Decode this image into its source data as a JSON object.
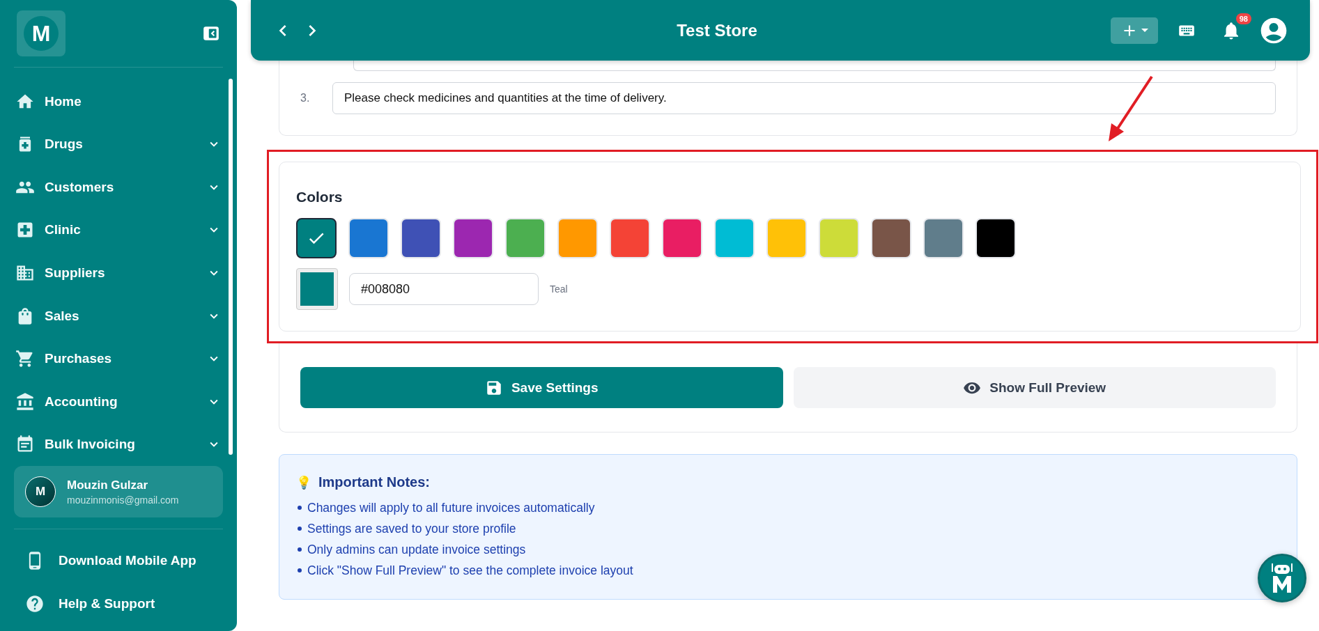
{
  "sidebar": {
    "logo": "M",
    "nav": [
      {
        "label": "Home",
        "expandable": false
      },
      {
        "label": "Drugs",
        "expandable": true
      },
      {
        "label": "Customers",
        "expandable": true
      },
      {
        "label": "Clinic",
        "expandable": true
      },
      {
        "label": "Suppliers",
        "expandable": true
      },
      {
        "label": "Sales",
        "expandable": true
      },
      {
        "label": "Purchases",
        "expandable": true
      },
      {
        "label": "Accounting",
        "expandable": true
      },
      {
        "label": "Bulk Invoicing",
        "expandable": true
      }
    ],
    "user": {
      "initial": "M",
      "name": "Mouzin Gulzar",
      "email": "mouzinmonis@gmail.com"
    },
    "footer_links": [
      "Download Mobile App",
      "Help & Support"
    ]
  },
  "header": {
    "title": "Test Store",
    "notification_count": "98"
  },
  "terms": [
    {
      "number": "3.",
      "text": "Please check medicines and quantities at the time of delivery."
    }
  ],
  "colors": {
    "title": "Colors",
    "swatches": [
      {
        "color": "#008080",
        "selected": true
      },
      {
        "color": "#1976d2",
        "selected": false
      },
      {
        "color": "#3f51b5",
        "selected": false
      },
      {
        "color": "#9c27b0",
        "selected": false
      },
      {
        "color": "#4caf50",
        "selected": false
      },
      {
        "color": "#ff9800",
        "selected": false
      },
      {
        "color": "#f44336",
        "selected": false
      },
      {
        "color": "#e91e63",
        "selected": false
      },
      {
        "color": "#00bcd4",
        "selected": false
      },
      {
        "color": "#ffc107",
        "selected": false
      },
      {
        "color": "#cddc39",
        "selected": false
      },
      {
        "color": "#795548",
        "selected": false
      },
      {
        "color": "#607d8b",
        "selected": false
      },
      {
        "color": "#000000",
        "selected": false
      }
    ],
    "hex_value": "#008080",
    "color_name": "Teal"
  },
  "actions": [
    "Save Settings",
    "Show Full Preview"
  ],
  "notes": {
    "icon": "💡",
    "title": "Important Notes:",
    "items": [
      "Changes will apply to all future invoices automatically",
      "Settings are saved to your store profile",
      "Only admins can update invoice settings",
      "Click \"Show Full Preview\" to see the complete invoice layout"
    ]
  }
}
